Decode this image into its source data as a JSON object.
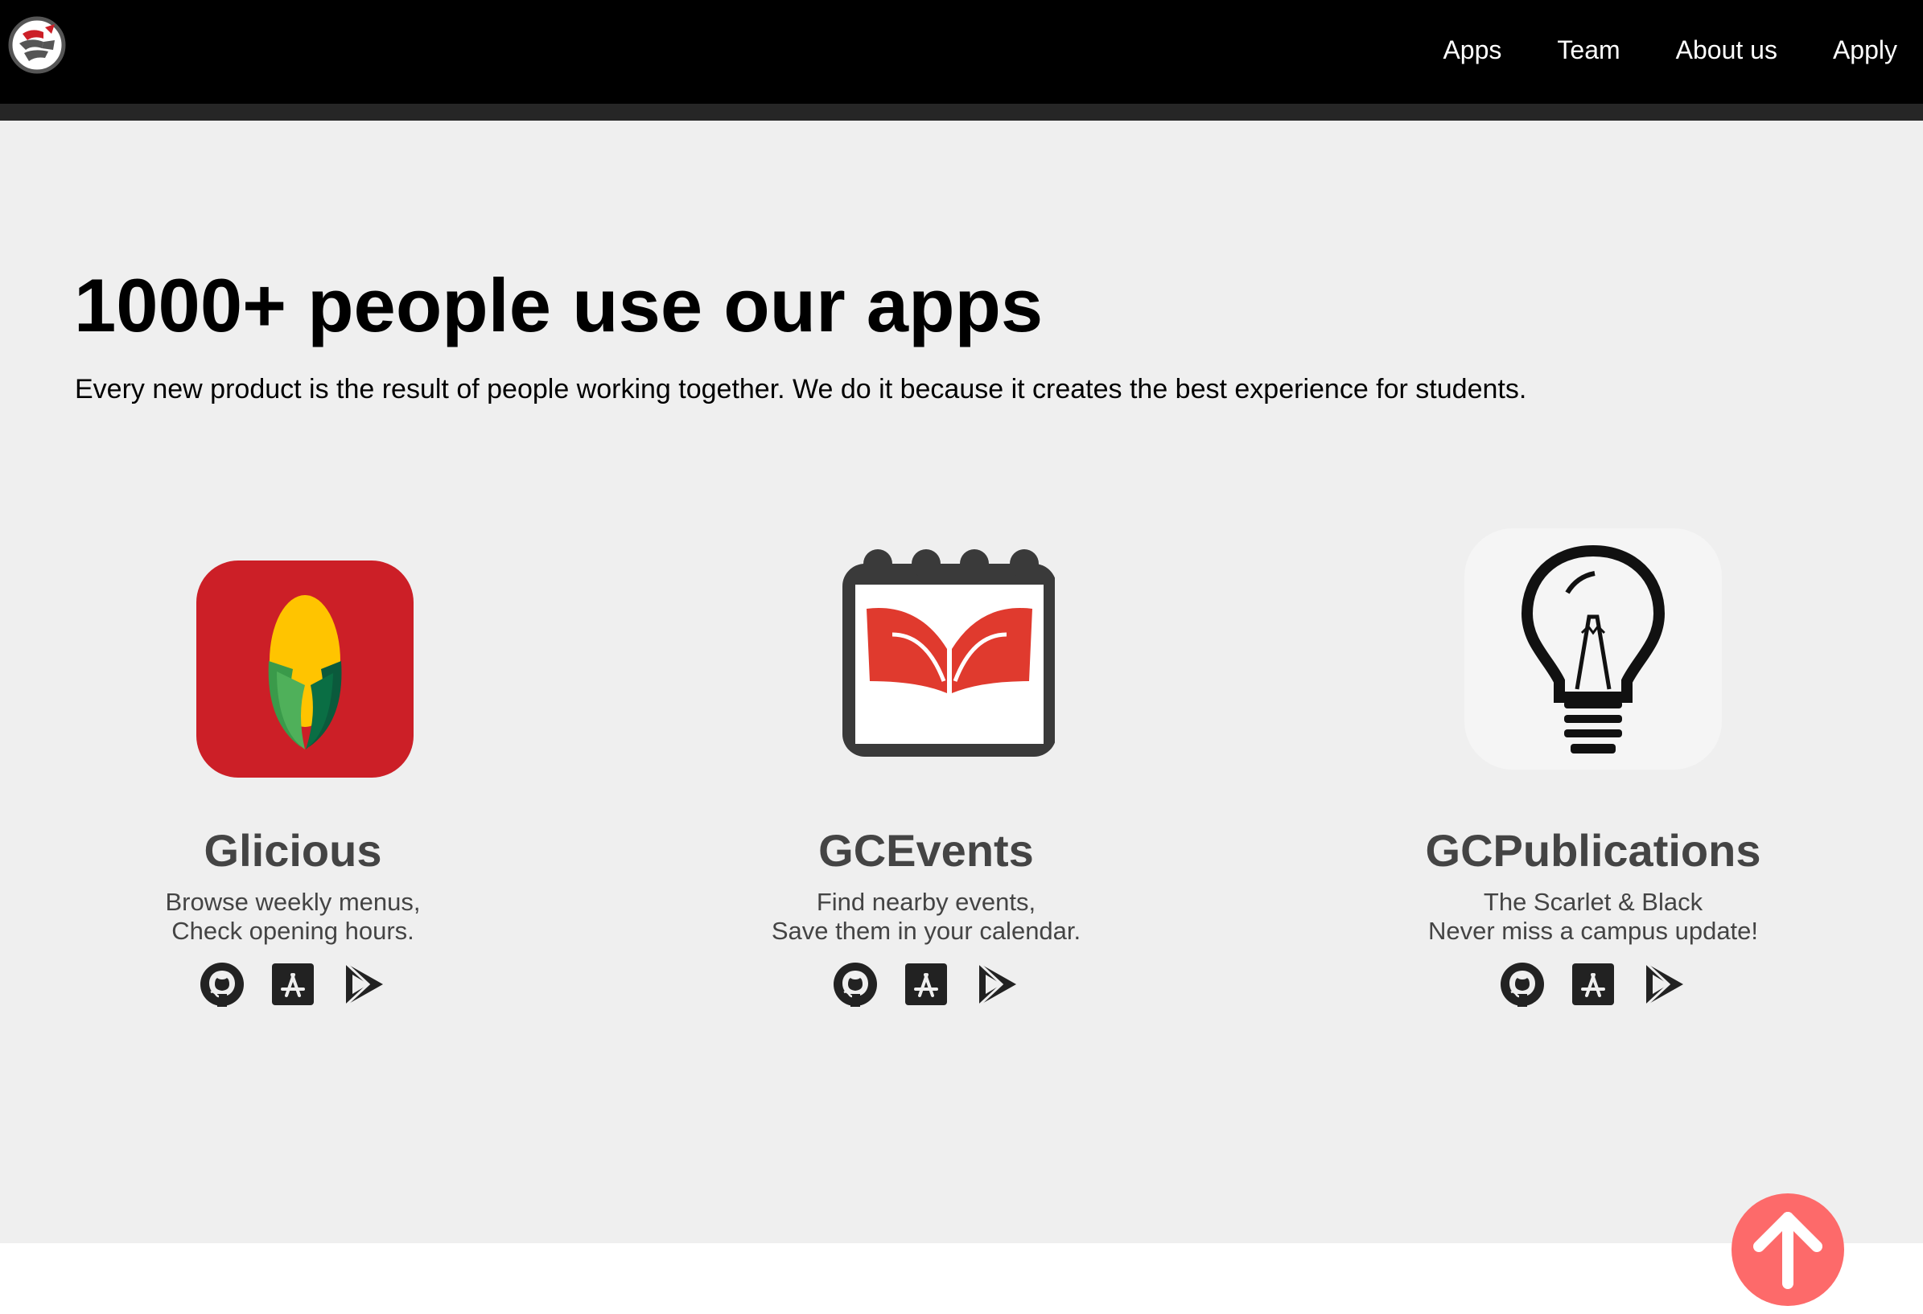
{
  "nav": {
    "links": [
      {
        "label": "Apps"
      },
      {
        "label": "Team"
      },
      {
        "label": "About us"
      },
      {
        "label": "Apply"
      }
    ]
  },
  "hero": {
    "headline": "1000+ people use our apps",
    "subtitle": "Every new product is the result of people working together. We do it because it creates the best experience for students."
  },
  "apps": [
    {
      "name": "Glicious",
      "desc_line1": "Browse weekly menus,",
      "desc_line2": "Check opening hours.",
      "icon": "corn-icon"
    },
    {
      "name": "GCEvents",
      "desc_line1": "Find nearby events,",
      "desc_line2": "Save them in your calendar.",
      "icon": "calendar-icon"
    },
    {
      "name": "GCPublications",
      "desc_line1": "The Scarlet & Black",
      "desc_line2": "Never miss a campus update!",
      "icon": "lightbulb-icon"
    }
  ],
  "store_icons": [
    "github-icon",
    "app-store-icon",
    "google-play-icon"
  ],
  "colors": {
    "nav_bg": "#000000",
    "nav_band": "#262626",
    "main_bg": "#efefef",
    "accent_red": "#cc1f27",
    "scroll_button": "#fd6a6a",
    "text_dark": "#444444"
  }
}
